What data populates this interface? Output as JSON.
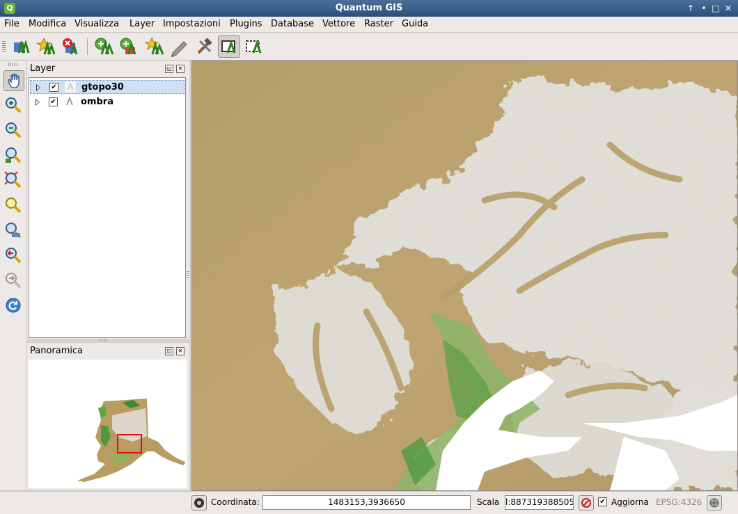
{
  "window": {
    "title": "Quantum GIS",
    "app_icon": "Q"
  },
  "menu": [
    "File",
    "Modifica",
    "Visualizza",
    "Layer",
    "Impostazioni",
    "Plugins",
    "Database",
    "Vettore",
    "Raster",
    "Guida"
  ],
  "toolbar": {
    "icons": [
      "add-vector-layer-icon",
      "add-raster-layer-icon",
      "remove-layer-icon",
      "new-shapefile-icon",
      "add-wms-layer-icon",
      "add-wfs-layer-icon",
      "digitize-icon",
      "tools-icon",
      "map-tips-icon",
      "overview-icon"
    ],
    "active_index": 8
  },
  "map_nav": {
    "icons": [
      "pan-icon",
      "zoom-in-icon",
      "zoom-out-icon",
      "zoom-full-icon",
      "zoom-selection-icon",
      "zoom-layer-icon",
      "zoom-actual-icon",
      "zoom-last-icon",
      "zoom-next-icon",
      "refresh-icon"
    ],
    "active_index": 0
  },
  "layers_panel": {
    "title": "Layer",
    "layers": [
      {
        "name": "gtopo30",
        "checked": "✔",
        "selected": true
      },
      {
        "name": "ombra",
        "checked": "✔",
        "selected": false
      }
    ]
  },
  "overview_panel": {
    "title": "Panoramica"
  },
  "status": {
    "coord_label": "Coordinata:",
    "coord_value": "1483153,3936650",
    "scale_label": "Scala",
    "scale_value": "l:887319388505",
    "render_label": "Aggiorna",
    "render_checked": "✔",
    "crs": "EPSG:4326"
  },
  "colors": {
    "lowland": "#b69b68",
    "coast": "#7fb05e",
    "snow": "#f4f4f4",
    "water": "#ffffff",
    "overview_box": "#dd1111"
  }
}
